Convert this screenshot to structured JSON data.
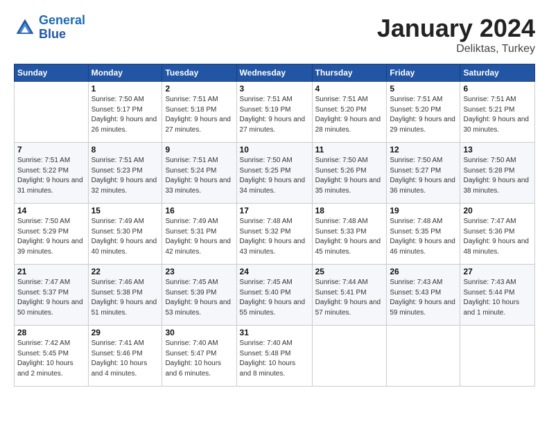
{
  "logo": {
    "line1": "General",
    "line2": "Blue"
  },
  "title": "January 2024",
  "subtitle": "Deliktas, Turkey",
  "days_header": [
    "Sunday",
    "Monday",
    "Tuesday",
    "Wednesday",
    "Thursday",
    "Friday",
    "Saturday"
  ],
  "weeks": [
    [
      {
        "num": "",
        "sunrise": "",
        "sunset": "",
        "daylight": ""
      },
      {
        "num": "1",
        "sunrise": "Sunrise: 7:50 AM",
        "sunset": "Sunset: 5:17 PM",
        "daylight": "Daylight: 9 hours and 26 minutes."
      },
      {
        "num": "2",
        "sunrise": "Sunrise: 7:51 AM",
        "sunset": "Sunset: 5:18 PM",
        "daylight": "Daylight: 9 hours and 27 minutes."
      },
      {
        "num": "3",
        "sunrise": "Sunrise: 7:51 AM",
        "sunset": "Sunset: 5:19 PM",
        "daylight": "Daylight: 9 hours and 27 minutes."
      },
      {
        "num": "4",
        "sunrise": "Sunrise: 7:51 AM",
        "sunset": "Sunset: 5:20 PM",
        "daylight": "Daylight: 9 hours and 28 minutes."
      },
      {
        "num": "5",
        "sunrise": "Sunrise: 7:51 AM",
        "sunset": "Sunset: 5:20 PM",
        "daylight": "Daylight: 9 hours and 29 minutes."
      },
      {
        "num": "6",
        "sunrise": "Sunrise: 7:51 AM",
        "sunset": "Sunset: 5:21 PM",
        "daylight": "Daylight: 9 hours and 30 minutes."
      }
    ],
    [
      {
        "num": "7",
        "sunrise": "Sunrise: 7:51 AM",
        "sunset": "Sunset: 5:22 PM",
        "daylight": "Daylight: 9 hours and 31 minutes."
      },
      {
        "num": "8",
        "sunrise": "Sunrise: 7:51 AM",
        "sunset": "Sunset: 5:23 PM",
        "daylight": "Daylight: 9 hours and 32 minutes."
      },
      {
        "num": "9",
        "sunrise": "Sunrise: 7:51 AM",
        "sunset": "Sunset: 5:24 PM",
        "daylight": "Daylight: 9 hours and 33 minutes."
      },
      {
        "num": "10",
        "sunrise": "Sunrise: 7:50 AM",
        "sunset": "Sunset: 5:25 PM",
        "daylight": "Daylight: 9 hours and 34 minutes."
      },
      {
        "num": "11",
        "sunrise": "Sunrise: 7:50 AM",
        "sunset": "Sunset: 5:26 PM",
        "daylight": "Daylight: 9 hours and 35 minutes."
      },
      {
        "num": "12",
        "sunrise": "Sunrise: 7:50 AM",
        "sunset": "Sunset: 5:27 PM",
        "daylight": "Daylight: 9 hours and 36 minutes."
      },
      {
        "num": "13",
        "sunrise": "Sunrise: 7:50 AM",
        "sunset": "Sunset: 5:28 PM",
        "daylight": "Daylight: 9 hours and 38 minutes."
      }
    ],
    [
      {
        "num": "14",
        "sunrise": "Sunrise: 7:50 AM",
        "sunset": "Sunset: 5:29 PM",
        "daylight": "Daylight: 9 hours and 39 minutes."
      },
      {
        "num": "15",
        "sunrise": "Sunrise: 7:49 AM",
        "sunset": "Sunset: 5:30 PM",
        "daylight": "Daylight: 9 hours and 40 minutes."
      },
      {
        "num": "16",
        "sunrise": "Sunrise: 7:49 AM",
        "sunset": "Sunset: 5:31 PM",
        "daylight": "Daylight: 9 hours and 42 minutes."
      },
      {
        "num": "17",
        "sunrise": "Sunrise: 7:48 AM",
        "sunset": "Sunset: 5:32 PM",
        "daylight": "Daylight: 9 hours and 43 minutes."
      },
      {
        "num": "18",
        "sunrise": "Sunrise: 7:48 AM",
        "sunset": "Sunset: 5:33 PM",
        "daylight": "Daylight: 9 hours and 45 minutes."
      },
      {
        "num": "19",
        "sunrise": "Sunrise: 7:48 AM",
        "sunset": "Sunset: 5:35 PM",
        "daylight": "Daylight: 9 hours and 46 minutes."
      },
      {
        "num": "20",
        "sunrise": "Sunrise: 7:47 AM",
        "sunset": "Sunset: 5:36 PM",
        "daylight": "Daylight: 9 hours and 48 minutes."
      }
    ],
    [
      {
        "num": "21",
        "sunrise": "Sunrise: 7:47 AM",
        "sunset": "Sunset: 5:37 PM",
        "daylight": "Daylight: 9 hours and 50 minutes."
      },
      {
        "num": "22",
        "sunrise": "Sunrise: 7:46 AM",
        "sunset": "Sunset: 5:38 PM",
        "daylight": "Daylight: 9 hours and 51 minutes."
      },
      {
        "num": "23",
        "sunrise": "Sunrise: 7:45 AM",
        "sunset": "Sunset: 5:39 PM",
        "daylight": "Daylight: 9 hours and 53 minutes."
      },
      {
        "num": "24",
        "sunrise": "Sunrise: 7:45 AM",
        "sunset": "Sunset: 5:40 PM",
        "daylight": "Daylight: 9 hours and 55 minutes."
      },
      {
        "num": "25",
        "sunrise": "Sunrise: 7:44 AM",
        "sunset": "Sunset: 5:41 PM",
        "daylight": "Daylight: 9 hours and 57 minutes."
      },
      {
        "num": "26",
        "sunrise": "Sunrise: 7:43 AM",
        "sunset": "Sunset: 5:43 PM",
        "daylight": "Daylight: 9 hours and 59 minutes."
      },
      {
        "num": "27",
        "sunrise": "Sunrise: 7:43 AM",
        "sunset": "Sunset: 5:44 PM",
        "daylight": "Daylight: 10 hours and 1 minute."
      }
    ],
    [
      {
        "num": "28",
        "sunrise": "Sunrise: 7:42 AM",
        "sunset": "Sunset: 5:45 PM",
        "daylight": "Daylight: 10 hours and 2 minutes."
      },
      {
        "num": "29",
        "sunrise": "Sunrise: 7:41 AM",
        "sunset": "Sunset: 5:46 PM",
        "daylight": "Daylight: 10 hours and 4 minutes."
      },
      {
        "num": "30",
        "sunrise": "Sunrise: 7:40 AM",
        "sunset": "Sunset: 5:47 PM",
        "daylight": "Daylight: 10 hours and 6 minutes."
      },
      {
        "num": "31",
        "sunrise": "Sunrise: 7:40 AM",
        "sunset": "Sunset: 5:48 PM",
        "daylight": "Daylight: 10 hours and 8 minutes."
      },
      {
        "num": "",
        "sunrise": "",
        "sunset": "",
        "daylight": ""
      },
      {
        "num": "",
        "sunrise": "",
        "sunset": "",
        "daylight": ""
      },
      {
        "num": "",
        "sunrise": "",
        "sunset": "",
        "daylight": ""
      }
    ]
  ]
}
